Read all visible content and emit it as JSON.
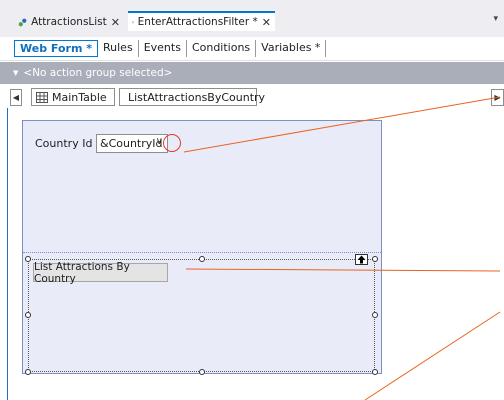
{
  "doc_tabs": [
    {
      "label": "AttractionsList",
      "close": "✕"
    },
    {
      "label": "EnterAttractionsFilter *",
      "close": "✕"
    }
  ],
  "tab_dropdown": "▾",
  "view_tabs": [
    "Web Form *",
    "Rules",
    "Events",
    "Conditions",
    "Variables *"
  ],
  "action_bar": {
    "arrow": "▼",
    "text": "<No action group selected>"
  },
  "breadcrumbs": [
    {
      "label": "MainTable",
      "icon": "table-icon"
    },
    {
      "label": "ListAttractionsByCountry",
      "icon": "button-icon"
    }
  ],
  "form": {
    "country_label": "Country Id",
    "country_value": "&CountryId",
    "country_chevron": "∨",
    "button_label": "List Attractions By Country",
    "up_arrow": "🡅"
  },
  "colors": {
    "accent": "#007acc",
    "annotation": "#e8641e",
    "circle": "#e33b2f"
  }
}
